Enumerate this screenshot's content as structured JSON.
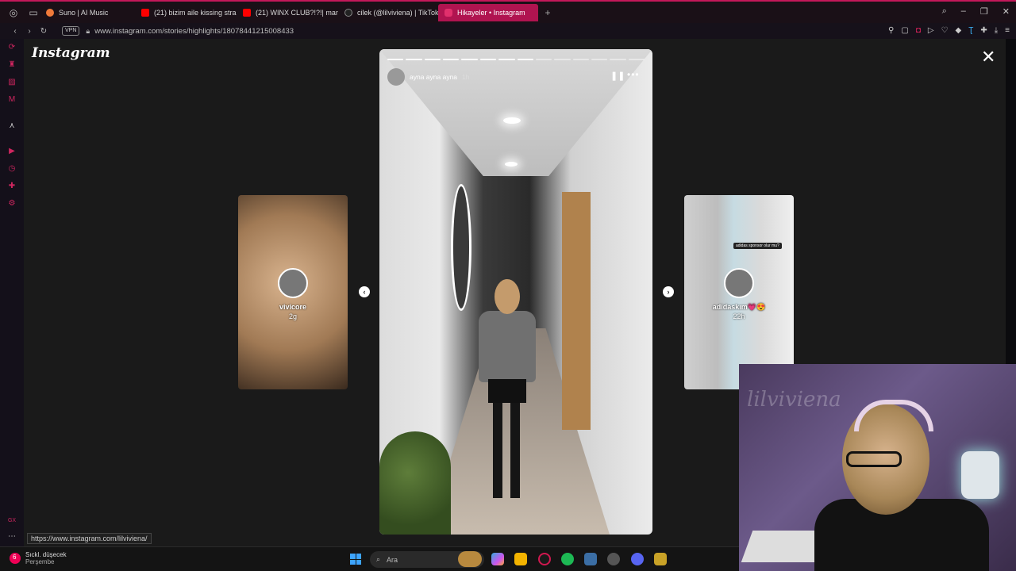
{
  "browser": {
    "tabs": [
      {
        "label": "Suno | AI Music",
        "favicon_color": "#f07a3a"
      },
      {
        "label": "(21) bizim aile kissing stra",
        "favicon_color": "#ff0000"
      },
      {
        "label": "(21) WINX CLUB?!?!| man",
        "favicon_color": "#ff0000"
      },
      {
        "label": "cilek (@lilviviena) | TikTok",
        "favicon_color": "#222222"
      },
      {
        "label": "Hikayeler • Instagram",
        "favicon_color": "#e1306c"
      }
    ],
    "active_tab_index": 4,
    "vpn_label": "VPN",
    "url": "www.instagram.com/stories/highlights/18078441215008433"
  },
  "instagram": {
    "logo": "Instagram",
    "story": {
      "username": "ayna ayna ayna",
      "time": "1h",
      "segments_total": 14,
      "segments_done": 8
    },
    "prev_story": {
      "name": "vivicore",
      "age": "2g"
    },
    "next_story": {
      "name": "adidaskım💗😍",
      "age": "22h",
      "overlay_text": "adidas sponsor olur mu?"
    }
  },
  "status_url": "https://www.instagram.com/lilviviena/",
  "taskbar": {
    "weather_title": "Sıckl. düşecek",
    "weather_day": "Perşembe",
    "weather_badge": "6",
    "search_placeholder": "Ara"
  },
  "webcam": {
    "wall_text": "lilviviena"
  },
  "sidebar": {
    "bottom_label": "GX"
  }
}
